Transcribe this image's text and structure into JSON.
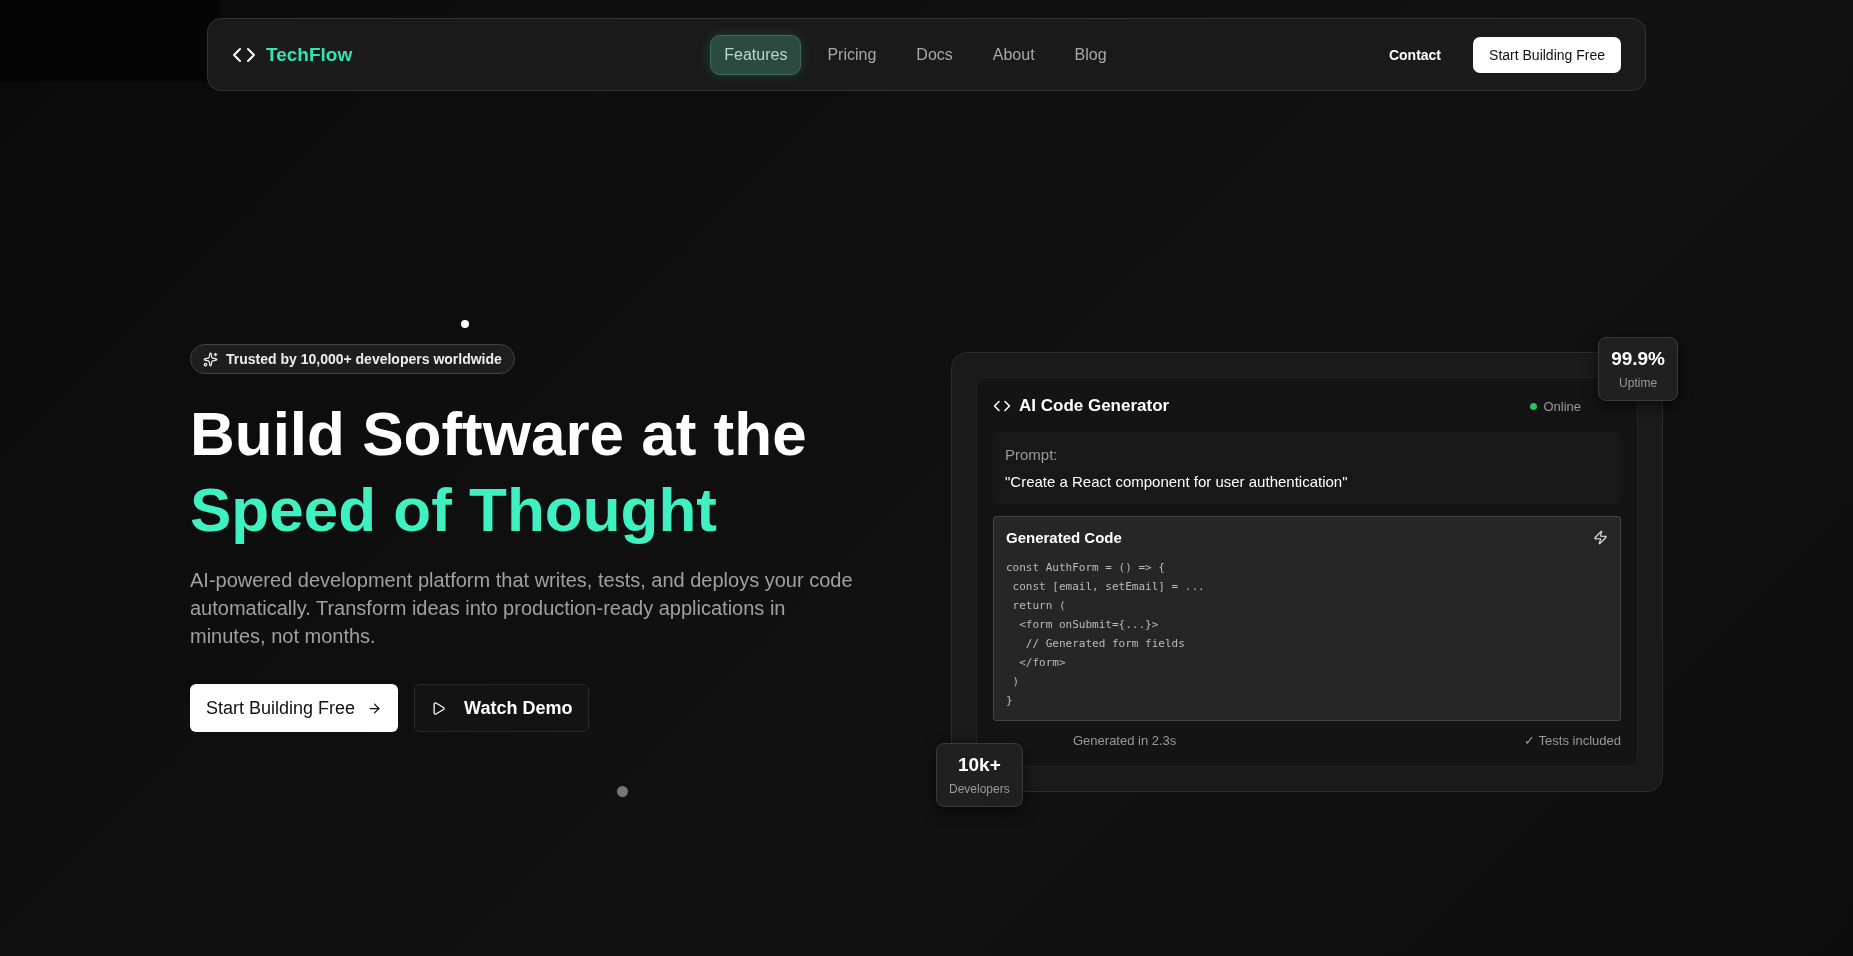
{
  "nav": {
    "logo": "TechFlow",
    "links": [
      {
        "label": "Features",
        "selected": true
      },
      {
        "label": "Pricing",
        "selected": false
      },
      {
        "label": "Docs",
        "selected": false
      },
      {
        "label": "About",
        "selected": false
      },
      {
        "label": "Blog",
        "selected": false
      }
    ],
    "contact": "Contact",
    "cta": "Start Building Free"
  },
  "hero": {
    "badge": "Trusted by 10,000+ developers worldwide",
    "title_line_1": "Build Software at the",
    "title_line_2": "Speed of Thought",
    "description": "AI-powered development platform that writes, tests, and deploys your code automatically. Transform ideas into production-ready applications in minutes, not months.",
    "primary_button": "Start Building Free",
    "secondary_button": "Watch Demo"
  },
  "generator": {
    "title": "AI Code Generator",
    "status": "Online",
    "prompt_label": "Prompt:",
    "prompt": "\"Create a React component for user authentication\"",
    "code_title": "Generated Code",
    "code_lines": [
      "const AuthForm = () => {",
      " const [email, setEmail] = ...",
      " return (",
      "  <form onSubmit={...}>",
      "   // Generated form fields",
      "  </form>",
      " )",
      "}"
    ],
    "footer_left": "Generated in 2.3s",
    "footer_right": "✓ Tests included"
  },
  "stats": [
    {
      "value": "99.9%",
      "label": "Uptime"
    },
    {
      "value": "10k+",
      "label": "Developers"
    }
  ]
}
